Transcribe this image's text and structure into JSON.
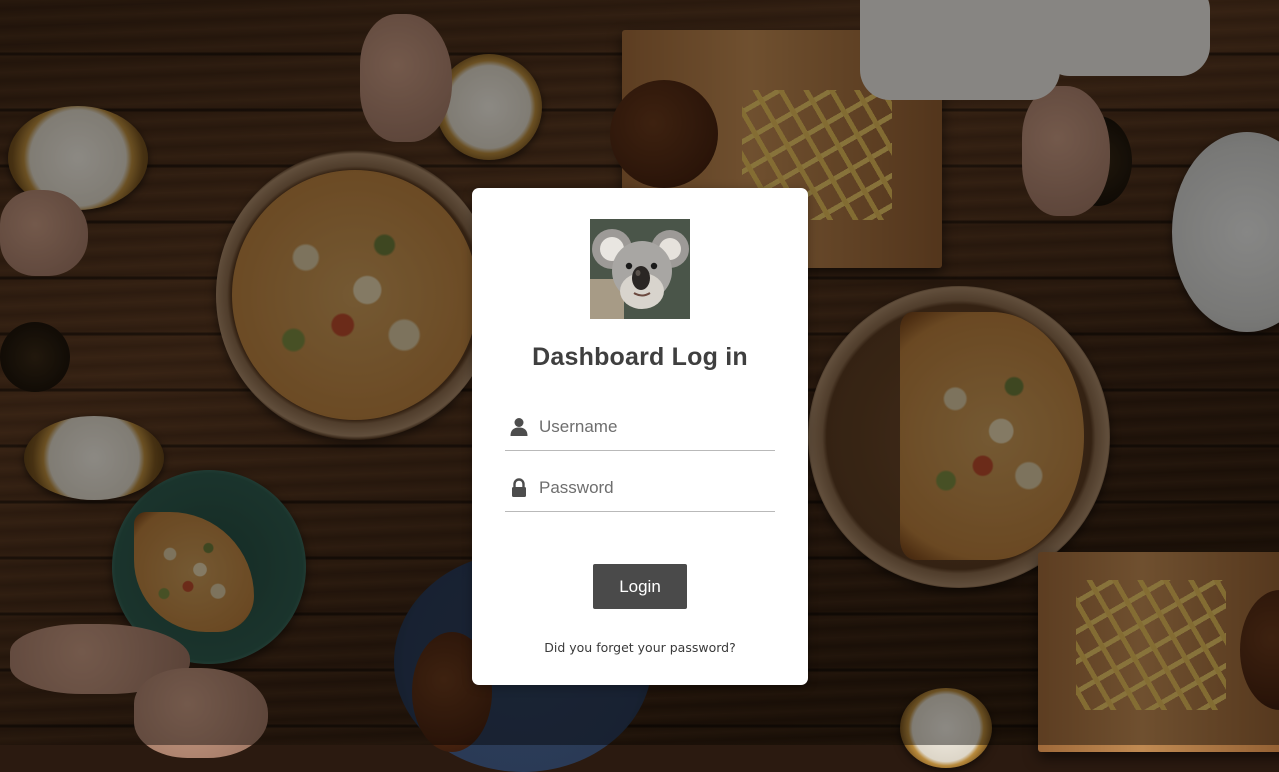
{
  "login_card": {
    "avatar_icon": "koala-avatar",
    "title": "Dashboard Log in",
    "username": {
      "icon": "user-icon",
      "placeholder": "Username",
      "value": ""
    },
    "password": {
      "icon": "lock-icon",
      "placeholder": "Password",
      "value": ""
    },
    "login_label": "Login",
    "forgot_label": "Did you forget your password?"
  },
  "colors": {
    "card_background": "#ffffff",
    "button_background": "#4a4a4a",
    "button_text": "#ffffff",
    "title_text": "#3f3f3f"
  }
}
